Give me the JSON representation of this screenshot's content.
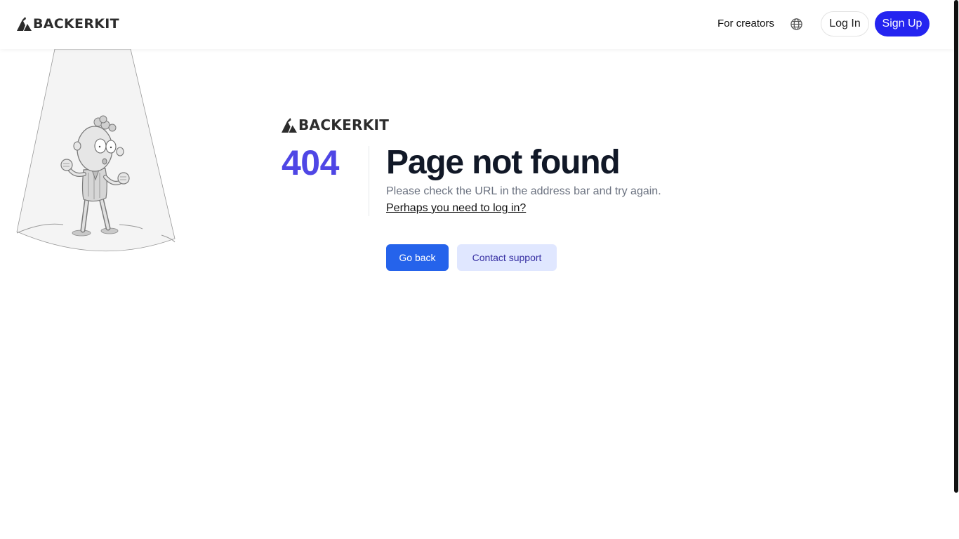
{
  "header": {
    "logo_text": "BACKERKIT",
    "nav": {
      "for_creators": "For creators"
    },
    "login_label": "Log In",
    "signup_label": "Sign Up",
    "globe_icon": "globe-icon"
  },
  "error": {
    "logo_text": "BACKERKIT",
    "code": "404",
    "title": "Page not found",
    "message": "Please check the URL in the address bar and try again.",
    "login_link": "Perhaps you need to log in?",
    "go_back_label": "Go back",
    "contact_support_label": "Contact support"
  },
  "colors": {
    "brand_blue": "#2424f0",
    "code_purple": "#4f46e5",
    "primary_button": "#2563eb",
    "secondary_button": "#e0e7ff",
    "secondary_button_text": "#3730a3"
  }
}
